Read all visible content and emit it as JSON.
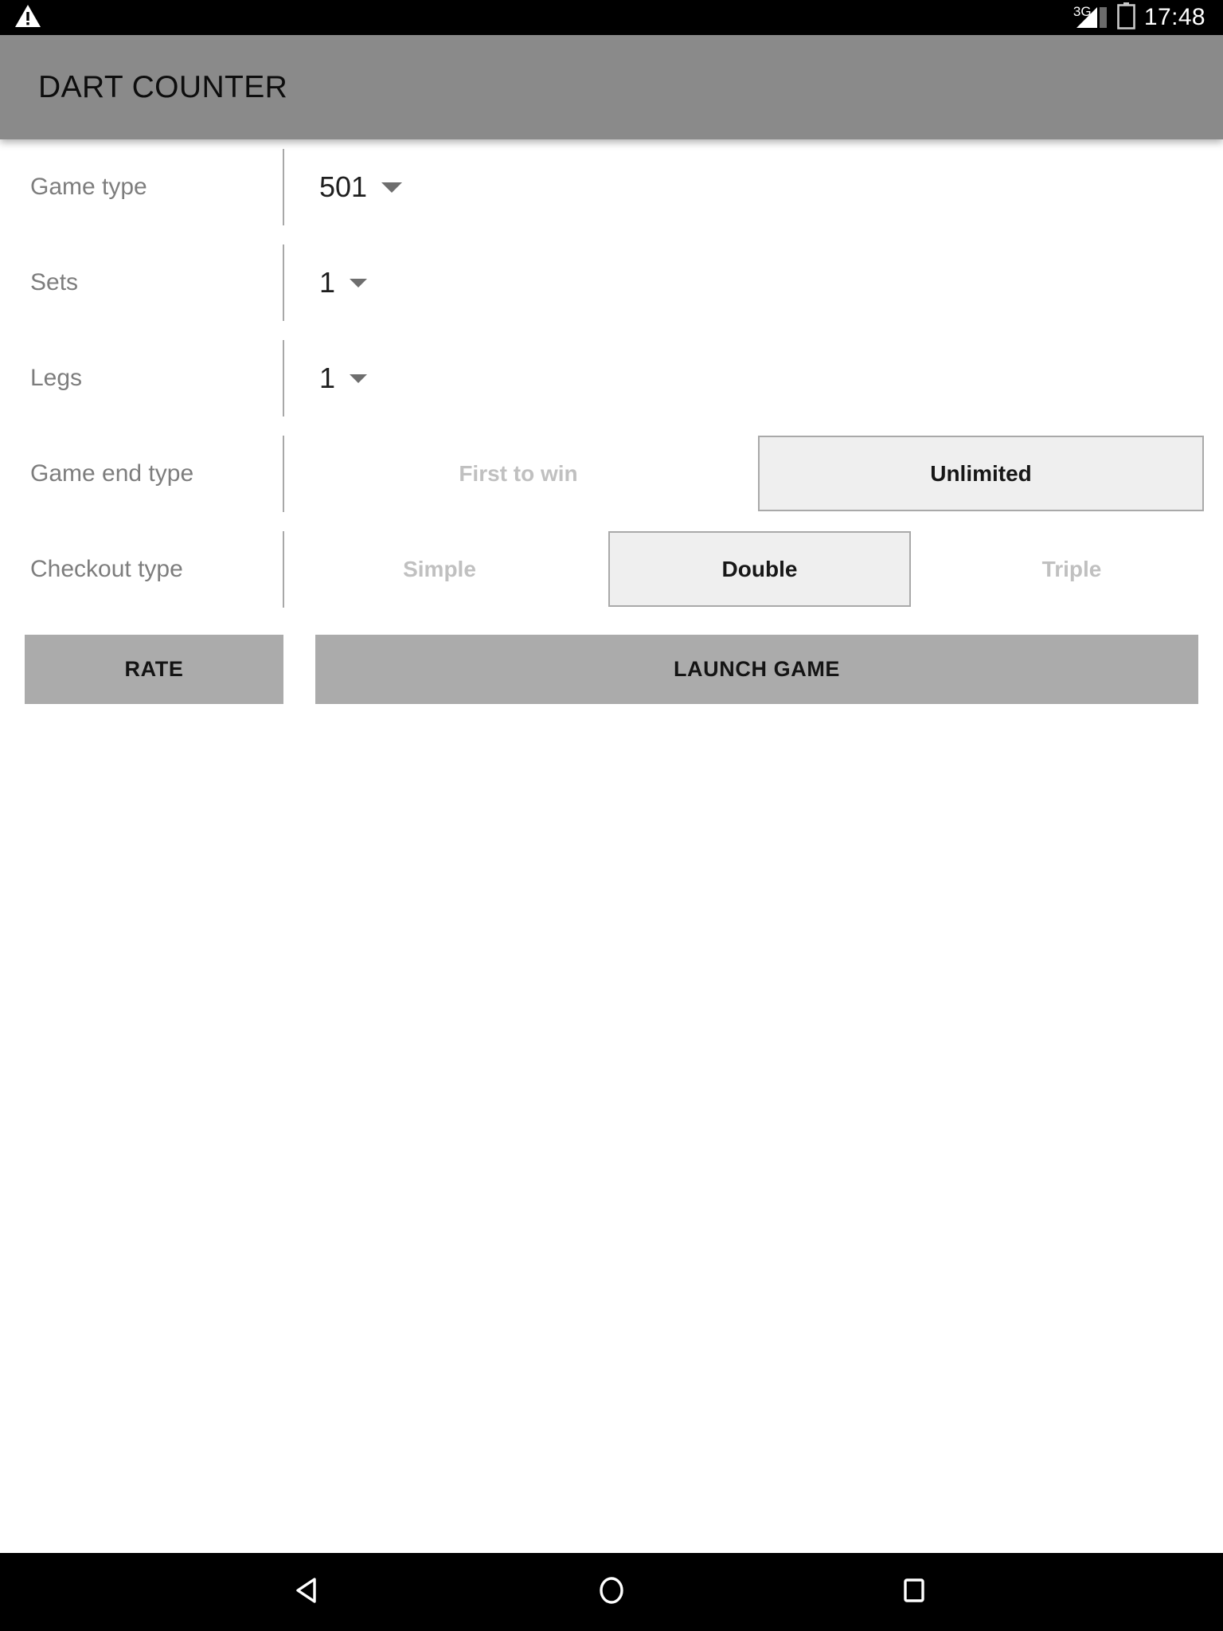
{
  "status_bar": {
    "warning_icon": "warning-triangle-icon",
    "network_type": "3G",
    "signal_icon": "signal-bars-icon",
    "battery_icon": "battery-charging-icon",
    "time": "17:48"
  },
  "app_bar": {
    "title": "DART COUNTER"
  },
  "form": {
    "rows": [
      {
        "label": "Game type",
        "value": "501",
        "caret_icon": "chevron-down-icon"
      },
      {
        "label": "Sets",
        "value": "1",
        "caret_icon": "chevron-down-icon"
      },
      {
        "label": "Legs",
        "value": "1",
        "caret_icon": "chevron-down-icon"
      }
    ],
    "game_end_type": {
      "label": "Game end type",
      "options": [
        {
          "label": "First to win",
          "selected": false
        },
        {
          "label": "Unlimited",
          "selected": true
        }
      ]
    },
    "checkout_type": {
      "label": "Checkout type",
      "options": [
        {
          "label": "Simple",
          "selected": false
        },
        {
          "label": "Double",
          "selected": true
        },
        {
          "label": "Triple",
          "selected": false
        }
      ]
    }
  },
  "actions": {
    "rate_label": "RATE",
    "launch_label": "LAUNCH GAME"
  },
  "nav_bar": {
    "back_icon": "back-triangle-icon",
    "home_icon": "home-circle-icon",
    "recents_icon": "recents-square-icon"
  },
  "colors": {
    "app_bar": "#8a8a8a",
    "button": "#ababab",
    "selected_fill": "#efefef",
    "selected_border": "#a9a9a9",
    "label_text": "#7d7d7d",
    "unselected_text": "#c0c0c0",
    "status_bar": "#000000"
  }
}
